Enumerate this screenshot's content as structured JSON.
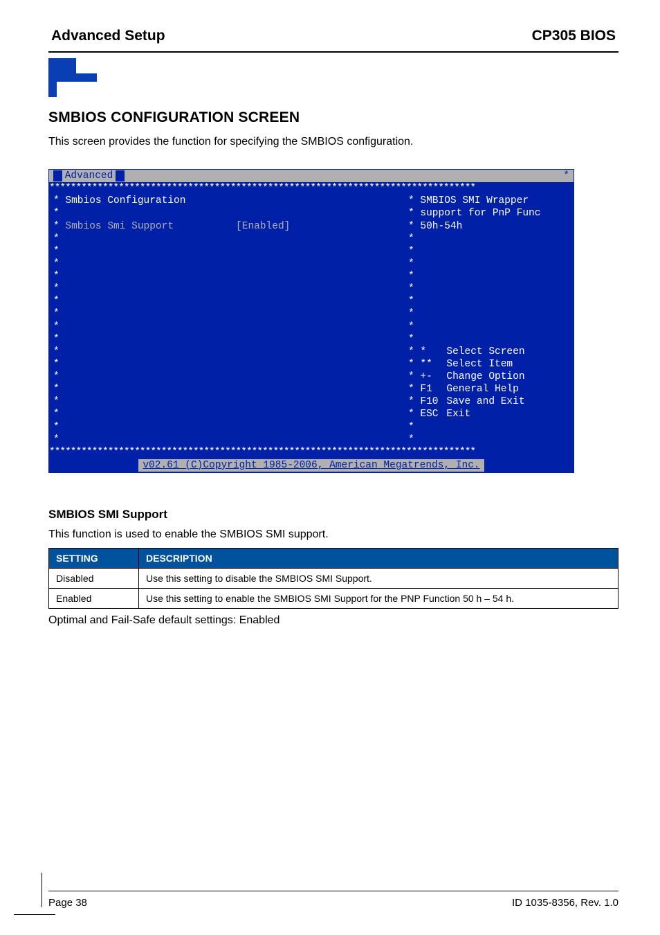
{
  "header": {
    "left": "Advanced Setup",
    "right": "CP305 BIOS"
  },
  "section_title": "SMBIOS CONFIGURATION SCREEN",
  "intro": "This screen provides the function for specifying the SMBIOS configuration.",
  "bios": {
    "tab": "Advanced",
    "group_title": "Smbios Configuration",
    "option_label": "Smbios Smi Support",
    "option_value": "[Enabled]",
    "help_lines": [
      "SMBIOS SMI Wrapper",
      "support for PnP Func",
      "50h-54h"
    ],
    "nav": {
      "select_screen": "Select Screen",
      "select_item": "Select Item",
      "change_option": "Change Option",
      "general_help": "General Help",
      "save_exit": "Save and Exit",
      "exit": "Exit",
      "k_star": "*",
      "k_stars": "**",
      "k_pm": "+-",
      "k_f1": "F1",
      "k_f10": "F10",
      "k_esc": "ESC"
    },
    "footer": "v02.61 (C)Copyright 1985-2006, American Megatrends, Inc."
  },
  "sub": {
    "heading": "SMBIOS SMI Support",
    "text": "This function is used to enable the SMBIOS SMI support."
  },
  "table": {
    "h1": "SETTING",
    "h2": "DESCRIPTION",
    "rows": [
      {
        "setting": "Disabled",
        "desc": "Use this setting to disable the SMBIOS SMI Support."
      },
      {
        "setting": "Enabled",
        "desc": "Use this setting to enable the SMBIOS SMI Support for the PNP Function 50 h – 54 h."
      }
    ]
  },
  "after_table": "Optimal and Fail-Safe default settings: Enabled",
  "footer": {
    "left": "Page 38",
    "right": "ID 1035-8356, Rev. 1.0"
  },
  "stars_full": "********************************************************************************",
  "star": "*"
}
